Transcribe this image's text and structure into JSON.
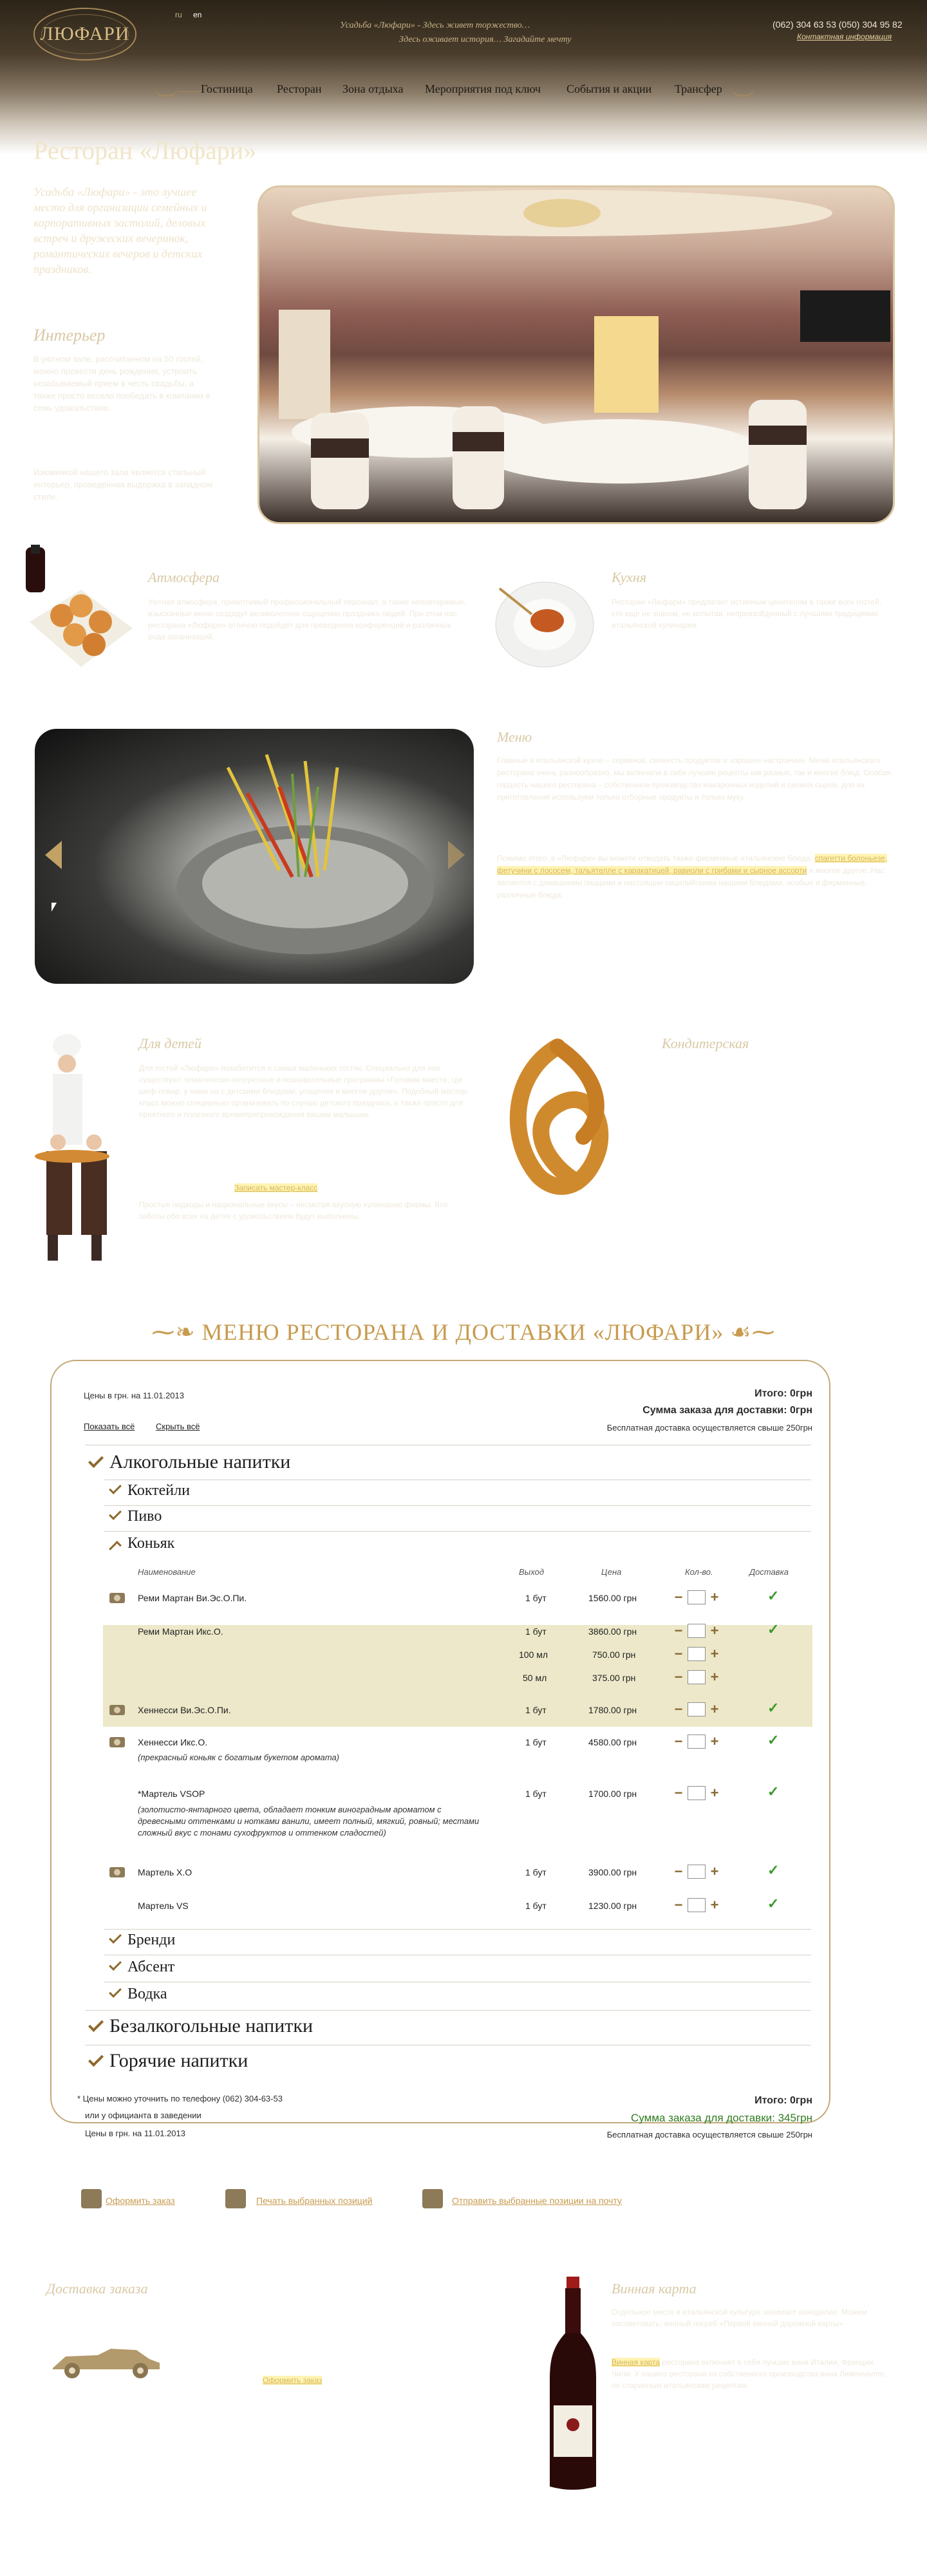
{
  "header": {
    "logo": "ЛЮФАРИ",
    "lang_ru": "ru",
    "lang_en": "en",
    "tagline1": "Усадьба «Люфари» - Здесь живет торжество…",
    "tagline2": "Здесь оживает история… Загадайте мечту",
    "phones": "(062) 304 63 53   (050) 304 95 82",
    "contacts_link": "Контактная информация",
    "nav": [
      "Гостиница",
      "Ресторан",
      "Зона отдыха",
      "Мероприятия под ключ",
      "События и акции",
      "Трансфер"
    ]
  },
  "intro": {
    "title": "Ресторан «Люфари»",
    "lead": "Усадьба «Люфари» - это лучшее место для организации семейных и корпоративных застолий, деловых встреч и дружеских вечеринок, романтических вечеров и детских праздников.",
    "interior_title": "Интерьер",
    "interior_text1": "В уютном зале, рассчитанном на 50 гостей, можно провести день рождения, устроить незабываемый прием в честь свадьбы, а также просто весело пообедать в компании в семь удовольствие.",
    "interior_text2": "Изюминкой нашего зала является стильный интерьер, проведенная выдержка в западном стиле."
  },
  "atmosphere": {
    "title": "Атмосфера",
    "text": "Уютная атмосфера, приветливый профессиональный персонал, а также неповторимые, изысканные меню создадут великолепное ощущение праздника людей. При этом нас ресторана «Люфари» отлично подойдёт для проведения конференций и различных рода организаций."
  },
  "kitchen": {
    "title": "Кухня",
    "text": "Ресторан «Люфари» предлагает истинным ценителям а также всех гостей, кто еще не знаком, не испытав, непревзойденный с лучшими традициями итальянской кулинарии."
  },
  "menu_section": {
    "title": "Меню",
    "text1": "Главные в итальянской кухне – сервинов, свежесть продуктов и хорошее настроение. Меню итальянского ресторана очень разнообразно, мы включили в себя лучшие рецепты как разных, так и многих блюд. Особая гордость нашего ресторана – собственное производство макаронных изделий и свежих сыров, для их приготовления используем только отборные продукты и только муку.",
    "text2": "Помимо этого, в «Люфари» вы можете отведать также фирменные итальянские блюда: ",
    "highlight1": "спагетти болоньезе, фетучини с лососем, тальятелле с каракатицей, равиоли с грибами и сырное ассорти",
    "text3": " и многое другое. Нас являются с домашними пиццами и настоящие сицилийскими нашими блюдами, особые и фирменные, различные блюда."
  },
  "kids": {
    "title": "Для детей",
    "text1": "Для гостей «Люфари» позаботится о самых маленьких гостях. Специально для них существуют тематически-интересные и познавательные программы «Готовим вместе, где шеф-повар, у нами на с детскими блюдами, угощения и многое другое». Подобный мастер-класс можно специально организовать по случаю детского праздника, а также просто для приятного и полезного времяпрепровождения вашим малышам.",
    "link": "Записать мастер-класс",
    "text2": "Простые подходы и национальные вкусы – несмотря вкусную кулинарию фирмы. Все заботы обо всех на детях с удовольствием будут выполнены."
  },
  "confectionery": {
    "title": "Кондитерская"
  },
  "menu": {
    "title": "МЕНЮ РЕСТОРАНА И ДОСТАВКИ «ЛЮФАРИ»",
    "prices_date": "Цены в грн. на 11.01.2013",
    "show_all": "Показать всё",
    "hide_all": "Скрыть всё",
    "total": "Итого: 0грн",
    "delivery_total": "Сумма заказа для доставки: 0грн",
    "free_delivery": "Бесплатная доставка осуществляется свыше 250грн",
    "cat_alcohol": "Алкогольные напитки",
    "sub_cocktails": "Коктейли",
    "sub_beer": "Пиво",
    "sub_cognac": "Коньяк",
    "th": {
      "name": "Наименование",
      "volume": "Выход",
      "price": "Цена",
      "qty": "Кол-во.",
      "delivery": "Доставка"
    },
    "items": [
      {
        "name": "Реми Мартан Ви.Эс.О.Пи.",
        "vol": "1 бут",
        "price": "1560.00 грн"
      },
      {
        "name": "Реми Мартан Икс.О.",
        "vol": "1 бут",
        "price": "3860.00 грн"
      },
      {
        "name": "",
        "vol": "100 мл",
        "price": "750.00 грн"
      },
      {
        "name": "",
        "vol": "50 мл",
        "price": "375.00 грн"
      },
      {
        "name": "Хеннесси Ви.Эс.О.Пи.",
        "vol": "1 бут",
        "price": "1780.00 грн"
      },
      {
        "name": "Хеннесси Икс.О.",
        "vol": "1 бут",
        "price": "4580.00 грн"
      },
      {
        "name": "*Мартель VSOP",
        "vol": "1 бут",
        "price": "1700.00 грн"
      },
      {
        "name": "Мартель Х.О",
        "vol": "1 бут",
        "price": "3900.00 грн"
      },
      {
        "name": "Мартель VS",
        "vol": "1 бут",
        "price": "1230.00 грн"
      }
    ],
    "note_hennessy": "(прекрасный коньяк с богатым букетом аромата)",
    "note_martell": "(золотисто-янтарного цвета, обладает тонким виноградным ароматом с древесными оттенками и нотками ванили, имеет полный, мягкий, ровный; местами сложный вкус с тонами сухофруктов и оттенком сладостей)",
    "sub_brandy": "Бренди",
    "sub_absinthe": "Абсент",
    "sub_vodka": "Водка",
    "cat_soft": "Безалкогольные напитки",
    "cat_hot": "Горячие напитки",
    "footnote1": "* Цены можно уточнить по телефону (062) 304-63-53",
    "footnote2": "или у официанта в заведении",
    "footer_date": "Цены в грн. на 11.01.2013",
    "footer_total": "Итого: 0грн",
    "footer_delivery": "Сумма заказа для доставки: 345грн",
    "footer_free": "Бесплатная доставка осуществляется свыше 250грн"
  },
  "actions": {
    "order": "Оформить заказ",
    "print": "Печать выбранных позиций",
    "mail": "Отправить выбранные позиции на почту"
  },
  "delivery": {
    "title": "Доставка заказа",
    "link": "Оформить заказ"
  },
  "wine": {
    "title": "Винная карта",
    "text1": "Отдельное место в итальянской культуре занимает виноделие. Можем посоветовать: винный погреб «Первой винной дорожной карты»",
    "link": "Винная карта",
    "text2": " ресторана включает в себя лучшие вина Италии, Франции, Чили. У нашего ресторана из собственного производства вина Лимончелло, по старинным итальянским рецептам."
  },
  "colors": {
    "accent": "#c79b4f",
    "nav_dark": "#2c2418",
    "check": "#3a9a2c",
    "band": "#ece8c9"
  }
}
